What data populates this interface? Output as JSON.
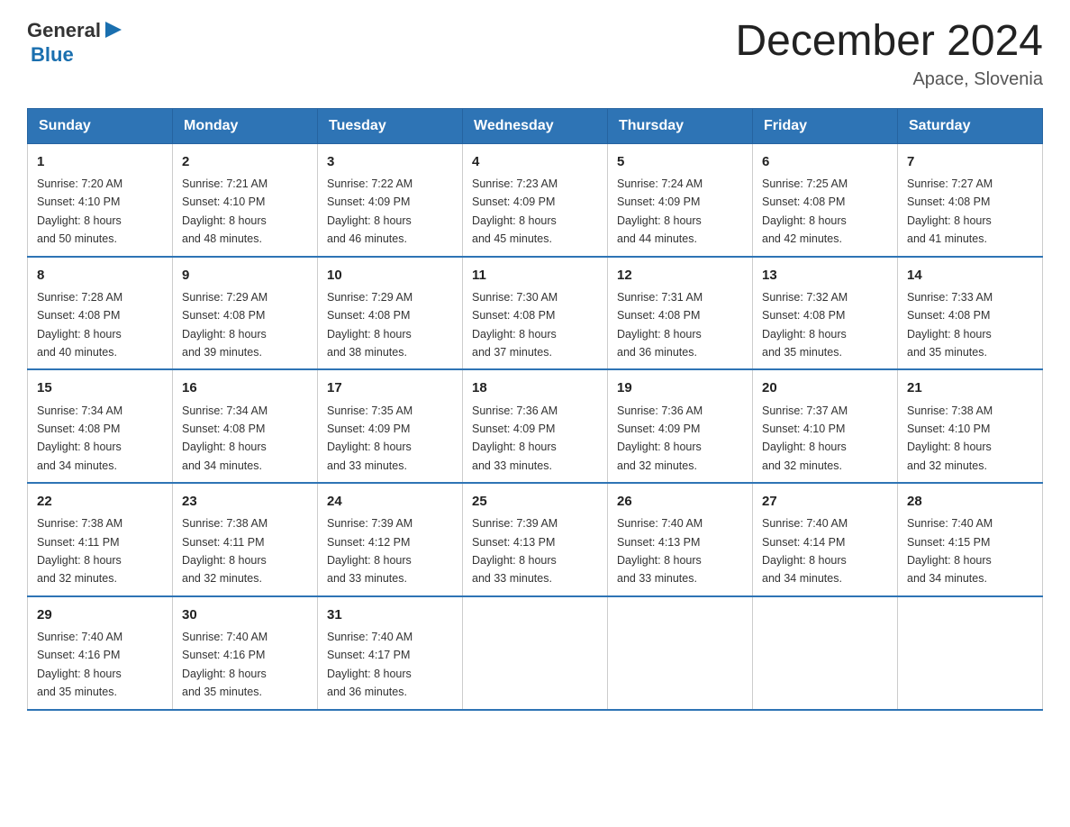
{
  "logo": {
    "general": "General",
    "triangle": "▶",
    "blue": "Blue"
  },
  "header": {
    "title": "December 2024",
    "subtitle": "Apace, Slovenia"
  },
  "days_of_week": [
    "Sunday",
    "Monday",
    "Tuesday",
    "Wednesday",
    "Thursday",
    "Friday",
    "Saturday"
  ],
  "weeks": [
    [
      {
        "day": "1",
        "sunrise": "7:20 AM",
        "sunset": "4:10 PM",
        "daylight": "8 hours and 50 minutes."
      },
      {
        "day": "2",
        "sunrise": "7:21 AM",
        "sunset": "4:10 PM",
        "daylight": "8 hours and 48 minutes."
      },
      {
        "day": "3",
        "sunrise": "7:22 AM",
        "sunset": "4:09 PM",
        "daylight": "8 hours and 46 minutes."
      },
      {
        "day": "4",
        "sunrise": "7:23 AM",
        "sunset": "4:09 PM",
        "daylight": "8 hours and 45 minutes."
      },
      {
        "day": "5",
        "sunrise": "7:24 AM",
        "sunset": "4:09 PM",
        "daylight": "8 hours and 44 minutes."
      },
      {
        "day": "6",
        "sunrise": "7:25 AM",
        "sunset": "4:08 PM",
        "daylight": "8 hours and 42 minutes."
      },
      {
        "day": "7",
        "sunrise": "7:27 AM",
        "sunset": "4:08 PM",
        "daylight": "8 hours and 41 minutes."
      }
    ],
    [
      {
        "day": "8",
        "sunrise": "7:28 AM",
        "sunset": "4:08 PM",
        "daylight": "8 hours and 40 minutes."
      },
      {
        "day": "9",
        "sunrise": "7:29 AM",
        "sunset": "4:08 PM",
        "daylight": "8 hours and 39 minutes."
      },
      {
        "day": "10",
        "sunrise": "7:29 AM",
        "sunset": "4:08 PM",
        "daylight": "8 hours and 38 minutes."
      },
      {
        "day": "11",
        "sunrise": "7:30 AM",
        "sunset": "4:08 PM",
        "daylight": "8 hours and 37 minutes."
      },
      {
        "day": "12",
        "sunrise": "7:31 AM",
        "sunset": "4:08 PM",
        "daylight": "8 hours and 36 minutes."
      },
      {
        "day": "13",
        "sunrise": "7:32 AM",
        "sunset": "4:08 PM",
        "daylight": "8 hours and 35 minutes."
      },
      {
        "day": "14",
        "sunrise": "7:33 AM",
        "sunset": "4:08 PM",
        "daylight": "8 hours and 35 minutes."
      }
    ],
    [
      {
        "day": "15",
        "sunrise": "7:34 AM",
        "sunset": "4:08 PM",
        "daylight": "8 hours and 34 minutes."
      },
      {
        "day": "16",
        "sunrise": "7:34 AM",
        "sunset": "4:08 PM",
        "daylight": "8 hours and 34 minutes."
      },
      {
        "day": "17",
        "sunrise": "7:35 AM",
        "sunset": "4:09 PM",
        "daylight": "8 hours and 33 minutes."
      },
      {
        "day": "18",
        "sunrise": "7:36 AM",
        "sunset": "4:09 PM",
        "daylight": "8 hours and 33 minutes."
      },
      {
        "day": "19",
        "sunrise": "7:36 AM",
        "sunset": "4:09 PM",
        "daylight": "8 hours and 32 minutes."
      },
      {
        "day": "20",
        "sunrise": "7:37 AM",
        "sunset": "4:10 PM",
        "daylight": "8 hours and 32 minutes."
      },
      {
        "day": "21",
        "sunrise": "7:38 AM",
        "sunset": "4:10 PM",
        "daylight": "8 hours and 32 minutes."
      }
    ],
    [
      {
        "day": "22",
        "sunrise": "7:38 AM",
        "sunset": "4:11 PM",
        "daylight": "8 hours and 32 minutes."
      },
      {
        "day": "23",
        "sunrise": "7:38 AM",
        "sunset": "4:11 PM",
        "daylight": "8 hours and 32 minutes."
      },
      {
        "day": "24",
        "sunrise": "7:39 AM",
        "sunset": "4:12 PM",
        "daylight": "8 hours and 33 minutes."
      },
      {
        "day": "25",
        "sunrise": "7:39 AM",
        "sunset": "4:13 PM",
        "daylight": "8 hours and 33 minutes."
      },
      {
        "day": "26",
        "sunrise": "7:40 AM",
        "sunset": "4:13 PM",
        "daylight": "8 hours and 33 minutes."
      },
      {
        "day": "27",
        "sunrise": "7:40 AM",
        "sunset": "4:14 PM",
        "daylight": "8 hours and 34 minutes."
      },
      {
        "day": "28",
        "sunrise": "7:40 AM",
        "sunset": "4:15 PM",
        "daylight": "8 hours and 34 minutes."
      }
    ],
    [
      {
        "day": "29",
        "sunrise": "7:40 AM",
        "sunset": "4:16 PM",
        "daylight": "8 hours and 35 minutes."
      },
      {
        "day": "30",
        "sunrise": "7:40 AM",
        "sunset": "4:16 PM",
        "daylight": "8 hours and 35 minutes."
      },
      {
        "day": "31",
        "sunrise": "7:40 AM",
        "sunset": "4:17 PM",
        "daylight": "8 hours and 36 minutes."
      },
      null,
      null,
      null,
      null
    ]
  ],
  "labels": {
    "sunrise": "Sunrise:",
    "sunset": "Sunset:",
    "daylight": "Daylight:"
  }
}
